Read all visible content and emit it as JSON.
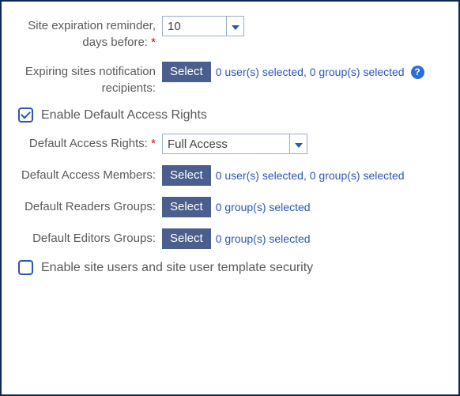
{
  "expiration": {
    "label": "Site expiration reminder, days before:",
    "required_mark": "*",
    "value": "10"
  },
  "expiring_recipients": {
    "label": "Expiring sites notification recipients:",
    "select_btn": "Select",
    "summary": "0 user(s) selected, 0 group(s) selected",
    "help_char": "?"
  },
  "enable_default_access": {
    "checked": true,
    "label": "Enable Default Access Rights"
  },
  "default_access_rights": {
    "label": "Default Access Rights:",
    "required_mark": "*",
    "value": "Full Access"
  },
  "default_access_members": {
    "label": "Default Access Members:",
    "select_btn": "Select",
    "summary": "0 user(s) selected, 0 group(s) selected"
  },
  "default_readers": {
    "label": "Default Readers Groups:",
    "select_btn": "Select",
    "summary": "0 group(s) selected"
  },
  "default_editors": {
    "label": "Default Editors Groups:",
    "select_btn": "Select",
    "summary": "0 group(s) selected"
  },
  "enable_site_users_sec": {
    "checked": false,
    "label": "Enable site users and site user template security"
  }
}
